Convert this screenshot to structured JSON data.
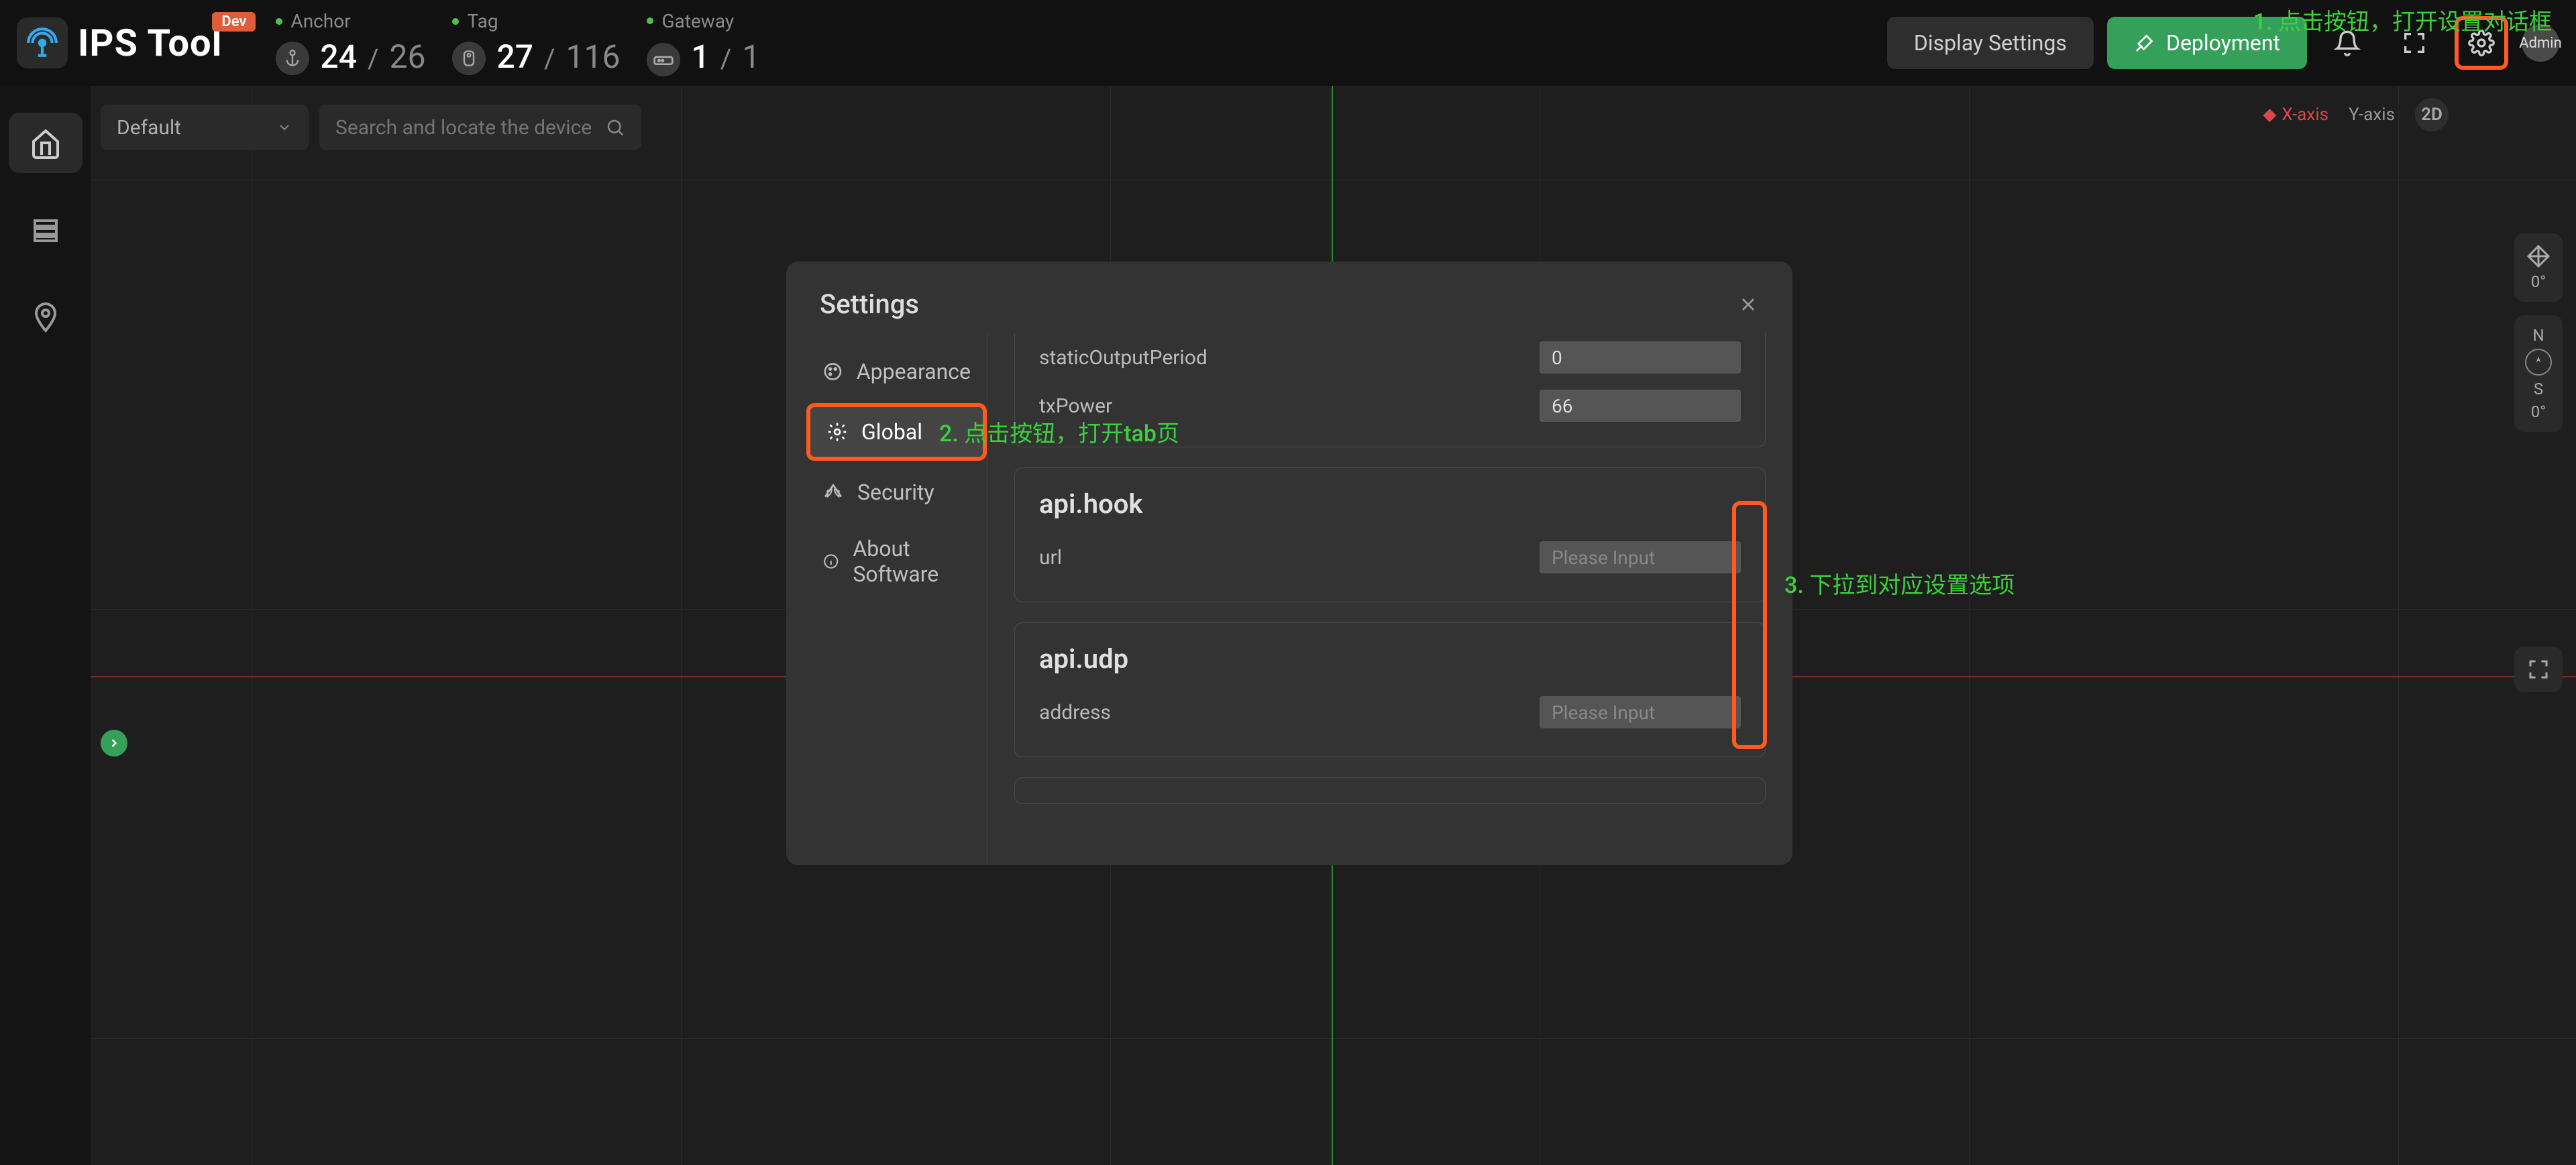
{
  "header": {
    "app_name": "IPS Tool",
    "dev_badge": "Dev",
    "stats": [
      {
        "label": "Anchor",
        "online": "24",
        "total": "26",
        "icon": "anchor-icon"
      },
      {
        "label": "Tag",
        "online": "27",
        "total": "116",
        "icon": "tag-icon"
      },
      {
        "label": "Gateway",
        "online": "1",
        "total": "1",
        "icon": "gateway-icon"
      }
    ],
    "display_settings": "Display Settings",
    "deployment": "Deployment",
    "admin": "Admin"
  },
  "map_toolbar": {
    "group_select": "Default",
    "search_placeholder": "Search and locate the device"
  },
  "axes": {
    "x": "X-axis",
    "y": "Y-axis",
    "mode": "2D",
    "rotation": "0°",
    "compass_n": "N",
    "compass_s": "S",
    "compass_deg": "0°"
  },
  "modal": {
    "title": "Settings",
    "sidebar": [
      {
        "id": "appearance",
        "label": "Appearance"
      },
      {
        "id": "global",
        "label": "Global"
      },
      {
        "id": "security",
        "label": "Security"
      },
      {
        "id": "about",
        "label": "About Software"
      }
    ],
    "global_form": {
      "staticOutputPeriod": {
        "label": "staticOutputPeriod",
        "value": "0"
      },
      "txPower": {
        "label": "txPower",
        "value": "66"
      },
      "api_hook": {
        "title": "api.hook",
        "url_label": "url",
        "url_placeholder": "Please Input"
      },
      "api_udp": {
        "title": "api.udp",
        "address_label": "address",
        "address_placeholder": "Please Input"
      }
    }
  },
  "annotations": {
    "a1": "1. 点击按钮，打开设置对话框",
    "a2": "2. 点击按钮，打开tab页",
    "a3": "3. 下拉到对应设置选项"
  }
}
